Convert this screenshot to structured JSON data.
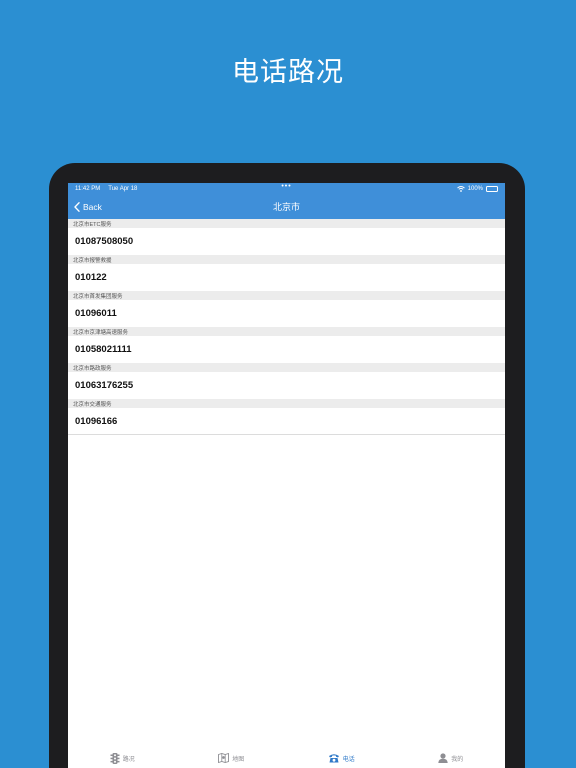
{
  "headline": "电话路况",
  "statusbar": {
    "time": "11:42 PM",
    "date": "Tue Apr 18",
    "battery": "100%"
  },
  "navbar": {
    "back_label": "Back",
    "title": "北京市"
  },
  "sections": [
    {
      "header": "北京市ETC服务",
      "phone": "01087508050"
    },
    {
      "header": "北京市报警救援",
      "phone": "010122"
    },
    {
      "header": "北京市首发集团服务",
      "phone": "01096011"
    },
    {
      "header": "北京市京津塘高速服务",
      "phone": "01058021111"
    },
    {
      "header": "北京市路政服务",
      "phone": "01063176255"
    },
    {
      "header": "北京市交通服务",
      "phone": "01096166"
    }
  ],
  "tabs": [
    {
      "label": "路况",
      "icon": "traffic-light-icon",
      "active": false
    },
    {
      "label": "地图",
      "icon": "map-icon",
      "active": false
    },
    {
      "label": "电话",
      "icon": "phone-icon",
      "active": true
    },
    {
      "label": "我的",
      "icon": "person-icon",
      "active": false
    }
  ],
  "colors": {
    "background": "#2b8fd2",
    "navbar": "#3f8fd9",
    "active_tab": "#2f79c8"
  }
}
